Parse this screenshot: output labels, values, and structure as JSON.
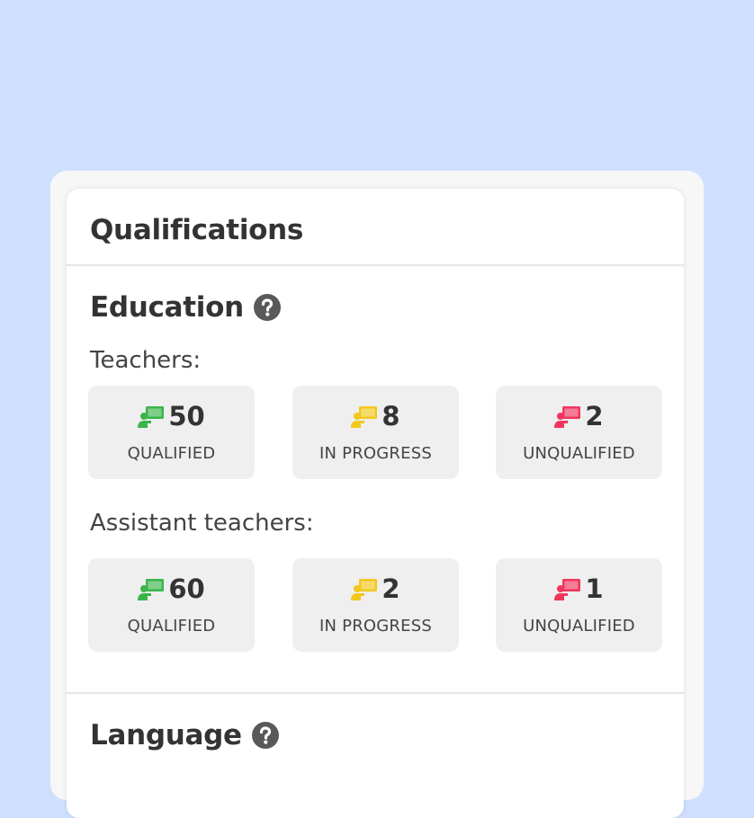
{
  "card": {
    "title": "Qualifications"
  },
  "education": {
    "title": "Education",
    "help_icon": "question-circle-icon",
    "teachers": {
      "label": "Teachers:",
      "stats": [
        {
          "value": "50",
          "label": "QUALIFIED",
          "icon": "teacher-board-icon",
          "color": "#3bb54a"
        },
        {
          "value": "8",
          "label": "IN PROGRESS",
          "icon": "teacher-board-icon",
          "color": "#f2c81c"
        },
        {
          "value": "2",
          "label": "UNQUALIFIED",
          "icon": "teacher-board-icon",
          "color": "#f0365e"
        }
      ]
    },
    "assistants": {
      "label": "Assistant teachers:",
      "stats": [
        {
          "value": "60",
          "label": "QUALIFIED",
          "icon": "teacher-board-icon",
          "color": "#3bb54a"
        },
        {
          "value": "2",
          "label": "IN PROGRESS",
          "icon": "teacher-board-icon",
          "color": "#f2c81c"
        },
        {
          "value": "1",
          "label": "UNQUALIFIED",
          "icon": "teacher-board-icon",
          "color": "#f0365e"
        }
      ]
    }
  },
  "language": {
    "title": "Language",
    "help_icon": "question-circle-icon"
  },
  "colors": {
    "background": "#cfe0fe",
    "qualified": "#3bb54a",
    "in_progress": "#f2c81c",
    "unqualified": "#f0365e"
  }
}
